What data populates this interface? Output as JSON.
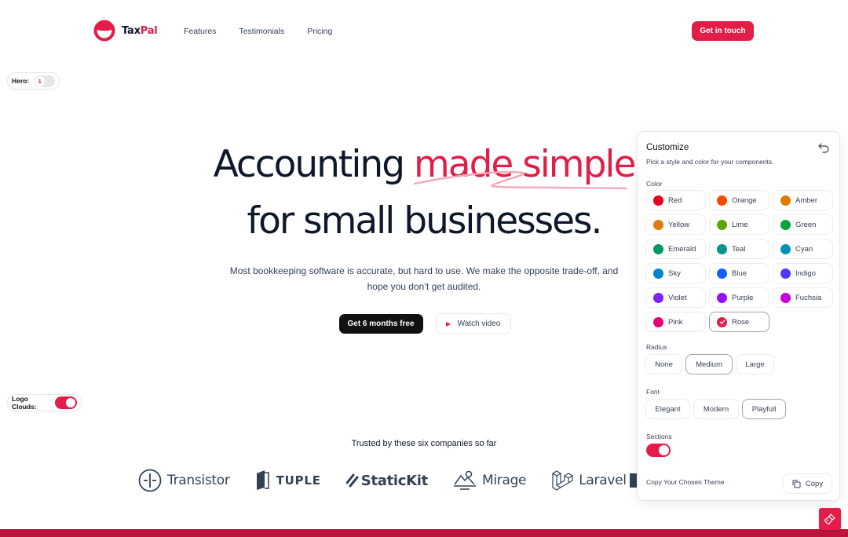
{
  "header": {
    "brand_prefix": "Tax",
    "brand_accent": "Pal",
    "nav": [
      "Features",
      "Testimonials",
      "Pricing"
    ],
    "cta": "Get in touch"
  },
  "controls": {
    "hero_label": "Hero:",
    "hero_value": "1",
    "logo_clouds_label": "Logo Clouds:",
    "logo_clouds_on": true
  },
  "hero": {
    "title_start": "Accounting ",
    "title_accent": "made simple",
    "title_line2": "for small businesses.",
    "subtitle": "Most bookkeeping software is accurate, but hard to use. We make the opposite trade-off, and hope you don’t get audited.",
    "primary_button": "Get 6 months free",
    "secondary_button": "Watch video"
  },
  "logo_cloud": {
    "heading": "Trusted by these six companies so far",
    "companies": [
      "Transistor",
      "TUPLE",
      "StaticKit",
      "Mirage",
      "Laravel"
    ]
  },
  "customize": {
    "title": "Customize",
    "description": "Pick a style and color for your components.",
    "color_label": "Color",
    "colors": [
      {
        "name": "Red",
        "hex": "#e7001b"
      },
      {
        "name": "Orange",
        "hex": "#f54a00"
      },
      {
        "name": "Amber",
        "hex": "#e07a00"
      },
      {
        "name": "Yellow",
        "hex": "#e07b10"
      },
      {
        "name": "Lime",
        "hex": "#5ea500"
      },
      {
        "name": "Green",
        "hex": "#00a63e"
      },
      {
        "name": "Emerald",
        "hex": "#009966"
      },
      {
        "name": "Teal",
        "hex": "#009689"
      },
      {
        "name": "Cyan",
        "hex": "#0092b8"
      },
      {
        "name": "Sky",
        "hex": "#0084d1"
      },
      {
        "name": "Blue",
        "hex": "#155dfc"
      },
      {
        "name": "Indigo",
        "hex": "#4f39f6"
      },
      {
        "name": "Violet",
        "hex": "#7f22fe"
      },
      {
        "name": "Purple",
        "hex": "#9810fa"
      },
      {
        "name": "Fuchsia",
        "hex": "#c800de"
      },
      {
        "name": "Pink",
        "hex": "#e60076"
      },
      {
        "name": "Rose",
        "hex": "#e11d48",
        "selected": true
      }
    ],
    "radius_label": "Radius",
    "radius_options": [
      "None",
      "Medium",
      "Large"
    ],
    "radius_selected": "Medium",
    "font_label": "Font",
    "font_options": [
      "Elegant",
      "Modern",
      "Playfull"
    ],
    "font_selected": "Playfull",
    "sections_label": "Sections",
    "sections_on": true,
    "copy_label": "Copy Your Chosen Theme",
    "copy_button": "Copy"
  },
  "theme": {
    "accent": "#e11d48",
    "accent_dark": "#be123c",
    "text": "#0f172a"
  }
}
